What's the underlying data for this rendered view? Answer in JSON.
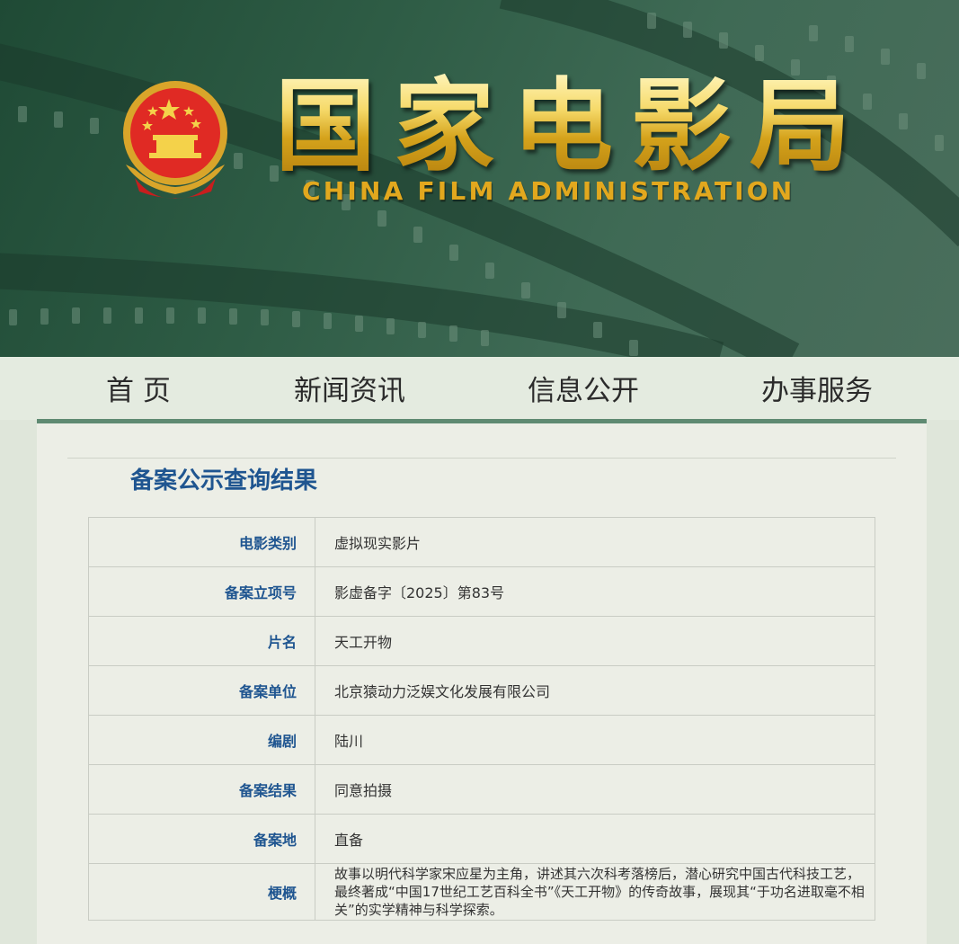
{
  "header": {
    "title_cn": [
      "国",
      "家",
      "电",
      "影",
      "局"
    ],
    "title_en": "CHINA FILM ADMINISTRATION",
    "emblem_icon": "national-emblem-icon"
  },
  "nav": {
    "items": [
      "首 页",
      "新闻资讯",
      "信息公开",
      "办事服务"
    ]
  },
  "main": {
    "heading": "备案公示查询结果",
    "rows": [
      {
        "label": "电影类别",
        "value": "虚拟现实影片"
      },
      {
        "label": "备案立项号",
        "value": "影虚备字〔2025〕第83号"
      },
      {
        "label": "片名",
        "value": "天工开物"
      },
      {
        "label": "备案单位",
        "value": "北京猿动力泛娱文化发展有限公司"
      },
      {
        "label": "编剧",
        "value": "陆川"
      },
      {
        "label": "备案结果",
        "value": "同意拍摄"
      },
      {
        "label": "备案地",
        "value": "直备"
      },
      {
        "label": "梗概",
        "value": "故事以明代科学家宋应星为主角，讲述其六次科考落榜后，潜心研究中国古代科技工艺，最终著成“中国17世纪工艺百科全书”《天工开物》的传奇故事，展现其“于功名进取毫不相关”的实学精神与科学探索。"
      }
    ]
  },
  "colors": {
    "banner_green": "#2e5c45",
    "gold": "#e2a81e",
    "label_blue": "#1f5590",
    "nav_line": "#5f8a72"
  }
}
